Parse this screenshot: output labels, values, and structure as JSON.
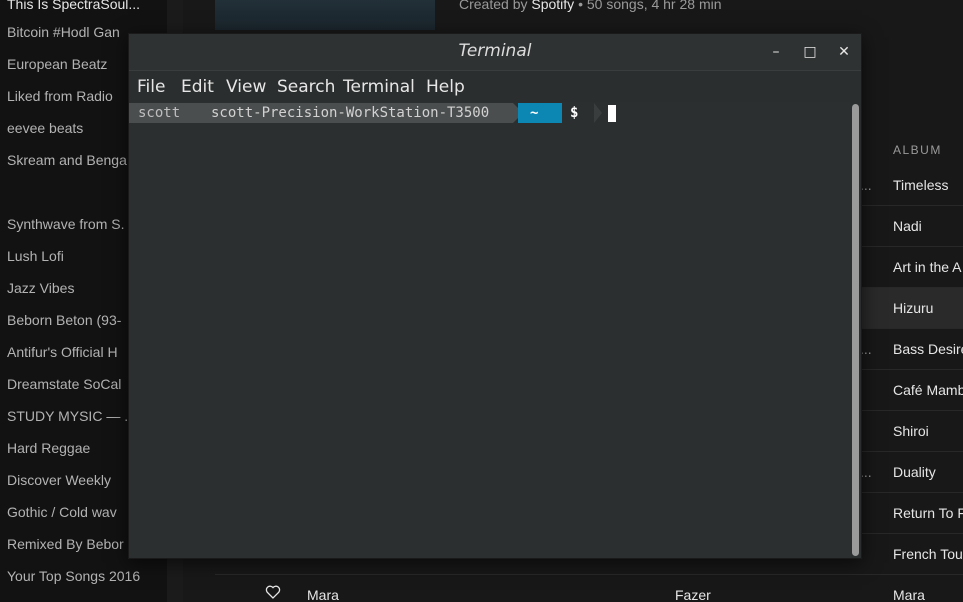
{
  "spotify": {
    "sidebar": {
      "playlists": [
        {
          "label": "This Is SpectraSoul..."
        },
        {
          "label": "Bitcoin #Hodl Gan"
        },
        {
          "label": "European Beatz"
        },
        {
          "label": "Liked from Radio"
        },
        {
          "label": "eevee beats"
        },
        {
          "label": "Skream and Benga"
        },
        {
          "label": "Synthwave from S."
        },
        {
          "label": "Lush Lofi"
        },
        {
          "label": "Jazz Vibes"
        },
        {
          "label": "Beborn Beton (93-"
        },
        {
          "label": "Antifur's Official H"
        },
        {
          "label": "Dreamstate SoCal"
        },
        {
          "label": "STUDY MYSIC — ."
        },
        {
          "label": "Hard Reggae"
        },
        {
          "label": "Discover Weekly"
        },
        {
          "label": "Gothic / Cold wav"
        },
        {
          "label": "Remixed By Bebor"
        },
        {
          "label": "Your Top Songs 2016"
        }
      ]
    },
    "playlist_header": {
      "created_by_prefix": "Created by",
      "owner": "Spotify",
      "meta": "• 50 songs, 4 hr 28 min"
    },
    "tracklist": {
      "album_header": "ALBUM",
      "ellipsis": "...",
      "rows": [
        {
          "album": "Timeless",
          "ellipsis": true
        },
        {
          "album": "Nadi",
          "ellipsis": false
        },
        {
          "album": "Art in the A",
          "ellipsis": false
        },
        {
          "album": "Hizuru",
          "ellipsis": false,
          "highlighted": true
        },
        {
          "album": "Bass Desire",
          "ellipsis": true
        },
        {
          "album": "Café Mamb",
          "ellipsis": false
        },
        {
          "album": "Shiroi",
          "ellipsis": false
        },
        {
          "album": "Duality",
          "ellipsis": true
        },
        {
          "album": "Return To F",
          "ellipsis": false
        },
        {
          "album": "French Tou",
          "ellipsis": false
        }
      ],
      "last_row": {
        "title": "Mara",
        "artist": "Fazer",
        "album": "Mara"
      }
    }
  },
  "terminal": {
    "title": "Terminal",
    "window_buttons": {
      "minimize": "–",
      "maximize": "□",
      "close": "✕"
    },
    "menu": {
      "file": "File",
      "edit": "Edit",
      "view": "View",
      "search": "Search",
      "terminal": "Terminal",
      "help": "Help"
    },
    "prompt": {
      "user": "scott",
      "host": "scott-Precision-WorkStation-T3500",
      "dir": "~",
      "symbol": "$"
    },
    "colors": {
      "dir_segment": "#0c87b4",
      "segment_bg": "#4b4e4f",
      "background": "#2c2f30"
    }
  }
}
